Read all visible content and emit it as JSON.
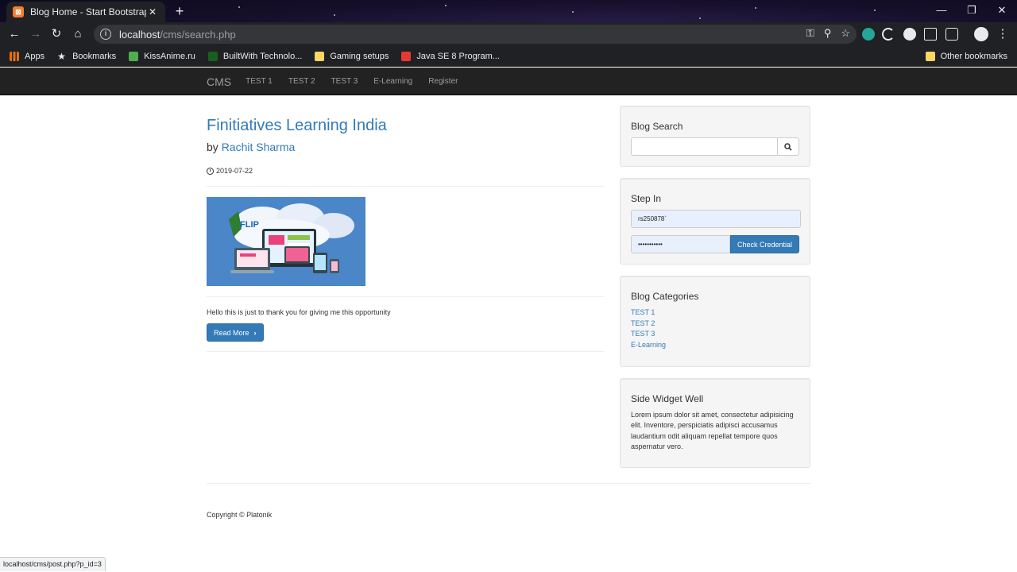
{
  "browser": {
    "tab_title": "Blog Home - Start Bootstrap Tem",
    "new_tab": "+",
    "url_host": "localhost",
    "url_path": "/cms/search.php",
    "bookmarks": [
      {
        "label": "Apps",
        "icon": "apps-grid-icon",
        "color": "#e8710a"
      },
      {
        "label": "Bookmarks",
        "icon": "star-icon",
        "color": "#e8eaed"
      },
      {
        "label": "KissAnime.ru",
        "icon": "kissanime-favicon",
        "color": "#4caf50"
      },
      {
        "label": "BuiltWith Technolo...",
        "icon": "builtwith-favicon",
        "color": "#1b5e20"
      },
      {
        "label": "Gaming setups",
        "icon": "folder-icon",
        "color": "#fdd663"
      },
      {
        "label": "Java SE 8 Program...",
        "icon": "oracle-favicon",
        "color": "#e53935"
      }
    ],
    "other_bookmarks": "Other bookmarks",
    "status_url": "localhost/cms/post.php?p_id=3"
  },
  "nav": {
    "brand": "CMS",
    "links": [
      "TEST 1",
      "TEST 2",
      "TEST 3",
      "E-Learning",
      "Register"
    ]
  },
  "post": {
    "title": "Finitiatives Learning India",
    "by": "by",
    "author": "Rachit Sharma",
    "date": "2019-07-22",
    "excerpt": "Hello this is just to thank you for giving me this opportunity",
    "read_more": "Read More"
  },
  "sidebar": {
    "search": {
      "title": "Blog Search",
      "value": ""
    },
    "login": {
      "title": "Step In",
      "username": "rs250878`",
      "password": "•••••••••••",
      "button": "Check Credential"
    },
    "categories": {
      "title": "Blog Categories",
      "items": [
        "TEST 1",
        "TEST 2",
        "TEST 3",
        "E-Learning"
      ]
    },
    "widget": {
      "title": "Side Widget Well",
      "text": "Lorem ipsum dolor sit amet, consectetur adipisicing elit. Inventore, perspiciatis adipisci accusamus laudantium odit aliquam repellat tempore quos aspernatur vero."
    }
  },
  "footer": {
    "copyright": "Copyright © Platonik"
  },
  "colors": {
    "link": "#337ab7",
    "navbar": "#222222",
    "well": "#f5f5f5"
  }
}
